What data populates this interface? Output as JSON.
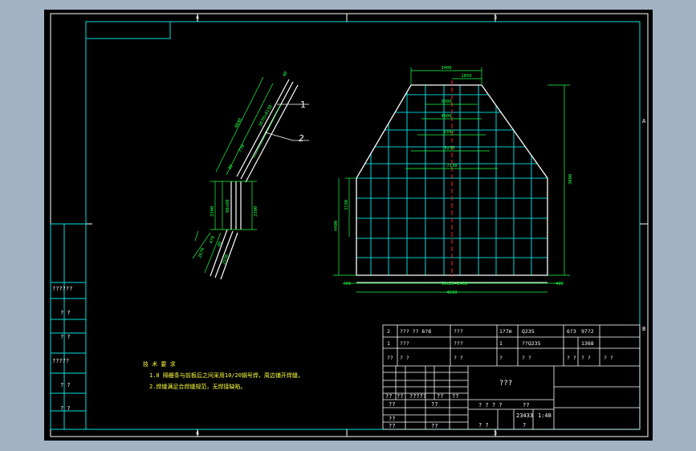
{
  "colors": {
    "background_outer": "#a3b2c3",
    "sheet": "#000000",
    "border": "#ffffff",
    "frame": "#00e0e0",
    "geometry": "#00c8c8",
    "dimension": "#22ff44",
    "centerline": "#ff2020",
    "annotation": "#ffffff"
  },
  "zone_markers": {
    "top": [
      "4",
      "3"
    ],
    "bottom": [
      "4",
      "3"
    ],
    "right": [
      "A",
      "B"
    ]
  },
  "side_view": {
    "part_callouts": [
      "1",
      "2"
    ],
    "dims_upper": [
      "40",
      "4040",
      "3070x4150",
      "770",
      "30"
    ],
    "dims_mid": [
      "2300",
      "80x80",
      "2300"
    ],
    "dims_lower": [
      "470",
      "40",
      "2670",
      "2930"
    ]
  },
  "front_view": {
    "dims_top": [
      "3400",
      "1850"
    ],
    "dims_inner": [
      "3000",
      "4880",
      "3347",
      "5235",
      "7130"
    ],
    "dim_right": "3000",
    "dims_left": [
      "3190",
      "4400"
    ],
    "dims_bottom": [
      "400",
      "50x20=2400",
      "4600",
      "400"
    ]
  },
  "tech_notes": {
    "heading": "技 术 要 求",
    "lines": [
      "1.0 隔栅条与前板后之间采用10/20钢号焊，周边铺开焊缝，",
      "2.焊缝满足合焊缝规范，无焊接缺陷。"
    ]
  },
  "left_stamp": [
    "??????",
    "? ?",
    "? ?",
    "?????",
    "? ?",
    "? ?"
  ],
  "bom": {
    "rows": [
      [
        "2",
        "??? ?? 6?8",
        "???",
        "1?7m",
        "Q235",
        "6?3",
        "97?2",
        ""
      ],
      [
        "1",
        "???",
        "???",
        "1",
        "??Q235",
        "",
        "1368",
        ""
      ],
      [
        "??",
        "?  ?",
        "?  ?",
        "?",
        "?  ?",
        "? ?",
        "? ?",
        "? ?"
      ]
    ]
  },
  "title_block": {
    "name": "???",
    "cells_left": [
      "??",
      "??",
      "?????",
      "??",
      "??"
    ],
    "cells_lower": [
      "??",
      "??",
      "??",
      "??",
      "??"
    ],
    "cells_mid": [
      "? ? ? ?",
      "??",
      "? ?",
      "?"
    ],
    "cells_right": [
      "23433",
      "1:48"
    ]
  }
}
